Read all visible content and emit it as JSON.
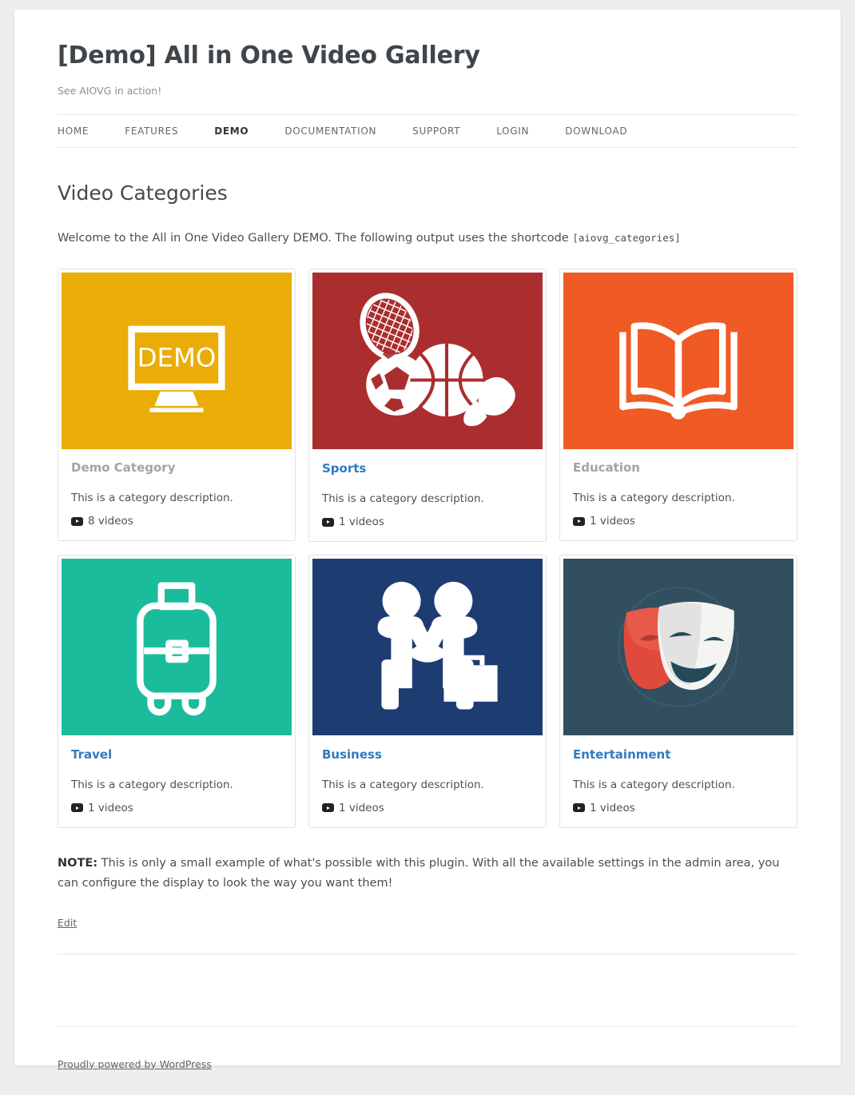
{
  "site": {
    "title": "[Demo] All in One Video Gallery",
    "description": "See AIOVG in action!"
  },
  "nav": {
    "items": [
      {
        "label": "HOME",
        "active": false
      },
      {
        "label": "FEATURES",
        "active": false
      },
      {
        "label": "DEMO",
        "active": true
      },
      {
        "label": "DOCUMENTATION",
        "active": false
      },
      {
        "label": "SUPPORT",
        "active": false
      },
      {
        "label": "LOGIN",
        "active": false
      },
      {
        "label": "DOWNLOAD",
        "active": false
      }
    ]
  },
  "entry": {
    "title": "Video Categories",
    "intro_text": "Welcome to the All in One Video Gallery DEMO. The following output uses the shortcode",
    "shortcode": "[aiovg_categories]"
  },
  "categories": [
    {
      "name": "Demo Category",
      "is_link": false,
      "description": "This is a category description.",
      "count_label": "8 videos",
      "icon": "demo-monitor-icon",
      "bg_color": "#eaac06"
    },
    {
      "name": "Sports",
      "is_link": true,
      "description": "This is a category description.",
      "count_label": "1 videos",
      "icon": "sports-balls-icon",
      "bg_color": "#ab2e2e"
    },
    {
      "name": "Education",
      "is_link": false,
      "description": "This is a category description.",
      "count_label": "1 videos",
      "icon": "open-book-icon",
      "bg_color": "#f05a24"
    },
    {
      "name": "Travel",
      "is_link": true,
      "description": "This is a category description.",
      "count_label": "1 videos",
      "icon": "suitcase-icon",
      "bg_color": "#1abc9c"
    },
    {
      "name": "Business",
      "is_link": true,
      "description": "This is a category description.",
      "count_label": "1 videos",
      "icon": "handshake-briefcase-icon",
      "bg_color": "#1d3c72"
    },
    {
      "name": "Entertainment",
      "is_link": true,
      "description": "This is a category description.",
      "count_label": "1 videos",
      "icon": "theatre-masks-icon",
      "bg_color": "#314f5f"
    }
  ],
  "note": {
    "label": "NOTE:",
    "text": " This is only a small example of what's possible with this plugin. With all the available settings in the admin area, you can configure the display to look the way you want them!"
  },
  "edit_link": "Edit",
  "footer": {
    "credit": "Proudly powered by WordPress"
  },
  "colors": {
    "link": "#2e7cc0",
    "muted_title": "#a0a4a8",
    "text": "#494f54",
    "page_bg": "#eeeeee"
  }
}
